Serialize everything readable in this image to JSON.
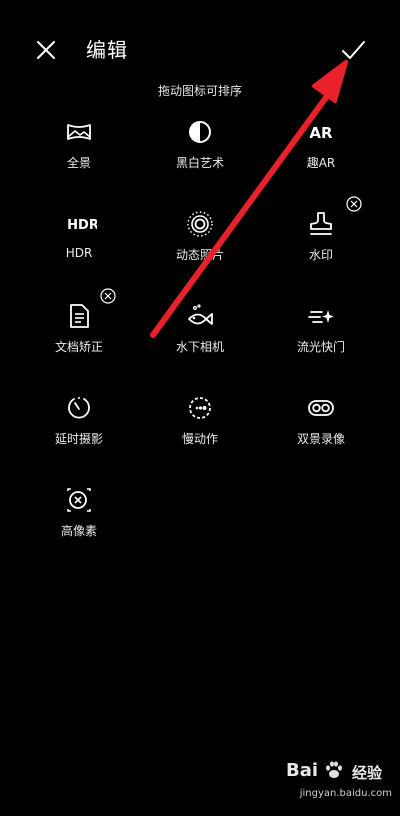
{
  "header": {
    "title": "编辑",
    "hint": "拖动图标可排序"
  },
  "modes": [
    {
      "label": "全景",
      "icon": "panorama-icon",
      "removable": false
    },
    {
      "label": "黑白艺术",
      "icon": "black-white-art-icon",
      "removable": false
    },
    {
      "label": "趣AR",
      "icon": "ar-icon",
      "removable": false
    },
    {
      "label": "HDR",
      "icon": "hdr-icon",
      "removable": false
    },
    {
      "label": "动态照片",
      "icon": "moving-picture-icon",
      "removable": false
    },
    {
      "label": "水印",
      "icon": "watermark-stamp-icon",
      "removable": true
    },
    {
      "label": "文档矫正",
      "icon": "document-icon",
      "removable": true
    },
    {
      "label": "水下相机",
      "icon": "underwater-fish-icon",
      "removable": false
    },
    {
      "label": "流光快门",
      "icon": "light-painting-icon",
      "removable": false
    },
    {
      "label": "延时摄影",
      "icon": "timelapse-icon",
      "removable": false
    },
    {
      "label": "慢动作",
      "icon": "slow-motion-icon",
      "removable": false
    },
    {
      "label": "双景录像",
      "icon": "dual-view-icon",
      "removable": false
    },
    {
      "label": "高像素",
      "icon": "high-resolution-icon",
      "removable": false
    }
  ],
  "hdr_icon_text": "HDR",
  "ar_icon_text": "AR",
  "watermark": {
    "brand": "Bai",
    "brand_cn": "经验",
    "url": "jingyan.baidu.com"
  },
  "colors": {
    "background": "#000000",
    "text": "#ffffff",
    "arrow": "#e8212a"
  }
}
